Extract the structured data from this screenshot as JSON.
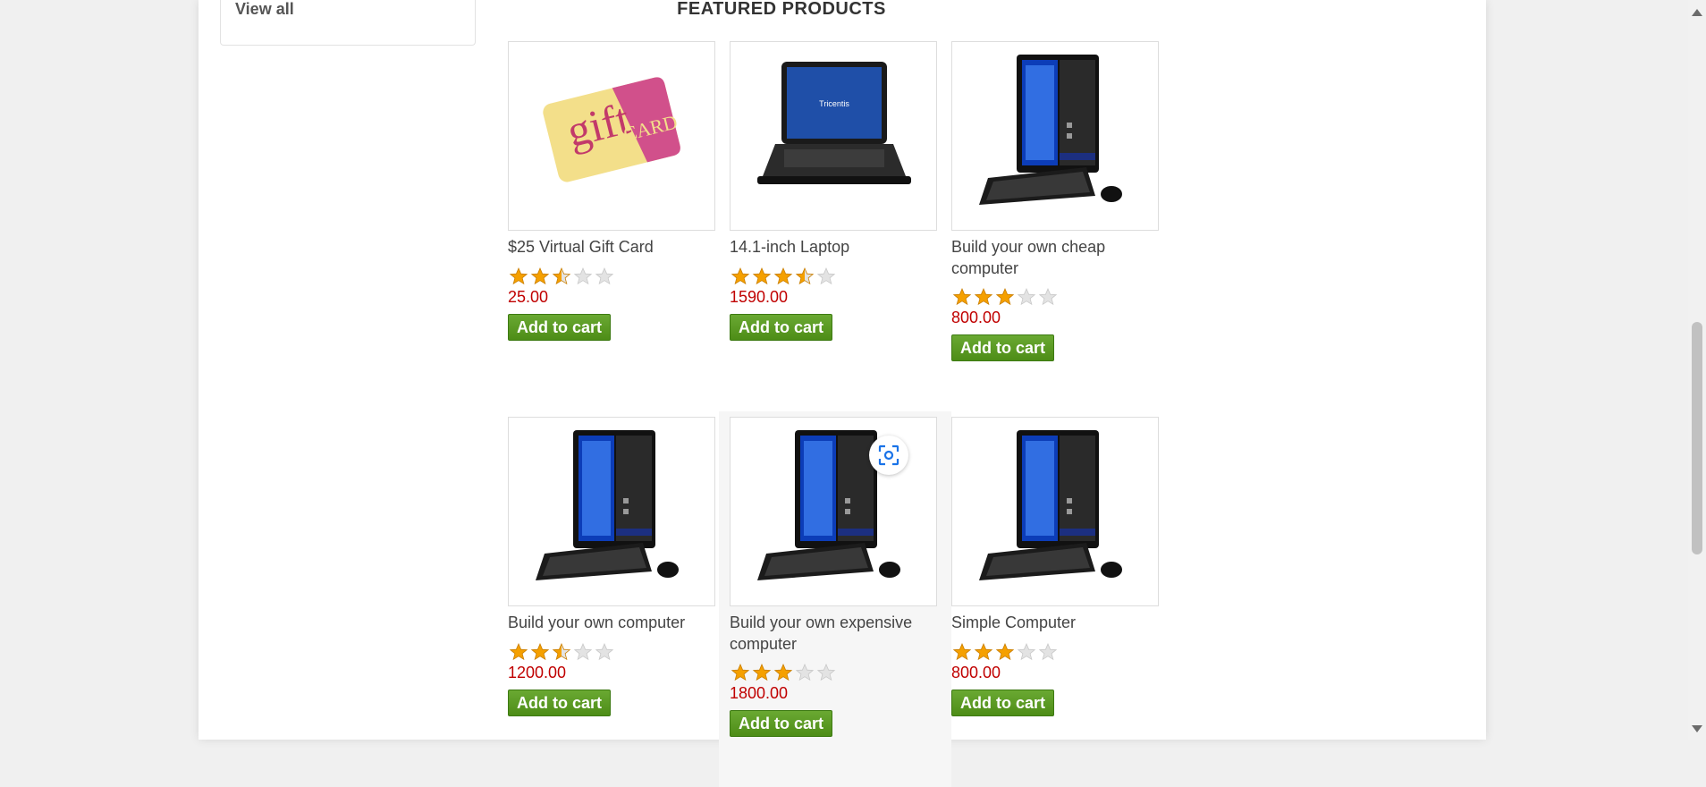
{
  "sidebar": {
    "view_all": "View all"
  },
  "featured": {
    "title": "FEATURED PRODUCTS",
    "products": [
      {
        "name": "$25 Virtual Gift Card",
        "price": "25.00",
        "rating": 2.5,
        "button": "Add to cart",
        "image": "gift-card-image"
      },
      {
        "name": "14.1-inch Laptop",
        "price": "1590.00",
        "rating": 3.5,
        "button": "Add to cart",
        "image": "laptop-image",
        "screen_text": "Tricentis"
      },
      {
        "name": "Build your own cheap computer",
        "price": "800.00",
        "rating": 3,
        "button": "Add to cart",
        "image": "desktop-computer-image"
      },
      {
        "name": "Build your own computer",
        "price": "1200.00",
        "rating": 2.5,
        "button": "Add to cart",
        "image": "desktop-computer-image"
      },
      {
        "name": "Build your own expensive computer",
        "price": "1800.00",
        "rating": 3,
        "button": "Add to cart",
        "image": "desktop-computer-image"
      },
      {
        "name": "Simple Computer",
        "price": "800.00",
        "rating": 3,
        "button": "Add to cart",
        "image": "desktop-computer-image"
      }
    ]
  },
  "colors": {
    "price": "#c00000",
    "button": "#4d8d17",
    "star": "#f5a000"
  },
  "overlay": {
    "lens_icon": "visual-search-icon"
  }
}
